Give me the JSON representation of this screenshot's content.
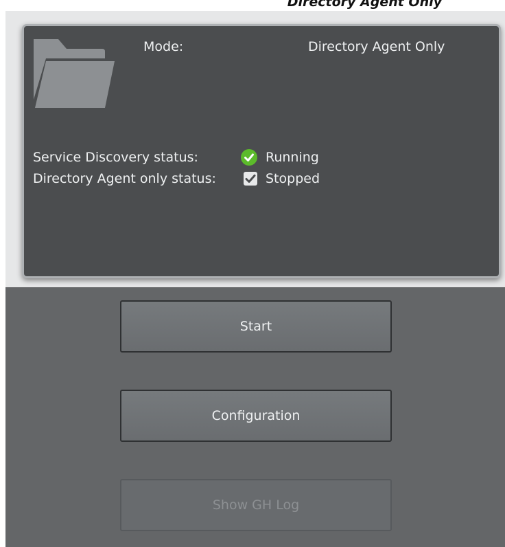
{
  "header": {
    "overflow_text": "Directory Agent Only"
  },
  "panel": {
    "icon": "folder-icon",
    "mode_label": "Mode:",
    "mode_value": "Directory Agent Only",
    "service_discovery": {
      "label": "Service Discovery status:",
      "icon": "green-check-circle-icon",
      "value": "Running"
    },
    "directory_agent": {
      "label": "Directory Agent only status:",
      "icon": "checkbox-checked-icon",
      "value": "Stopped"
    }
  },
  "buttons": {
    "start": "Start",
    "configuration": "Configuration",
    "show_gh_log": "Show GH Log"
  },
  "colors": {
    "panel_bg": "#4b4d4f",
    "panel_border": "#aeb1b4",
    "page_bg": "#646668",
    "running_green": "#5cbb2b"
  }
}
